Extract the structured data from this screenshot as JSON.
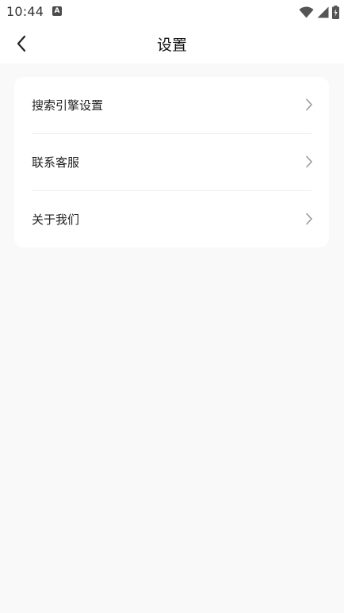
{
  "status_bar": {
    "time": "10:44",
    "notification_icon": "a-icon",
    "icons": [
      "wifi-icon",
      "signal-icon",
      "battery-icon"
    ]
  },
  "header": {
    "back_icon": "chevron-left-icon",
    "title": "设置"
  },
  "settings": {
    "items": [
      {
        "label": "搜索引擎设置",
        "icon": "chevron-right-icon"
      },
      {
        "label": "联系客服",
        "icon": "chevron-right-icon"
      },
      {
        "label": "关于我们",
        "icon": "chevron-right-icon"
      }
    ]
  },
  "colors": {
    "background": "#f9f9f9",
    "card": "#ffffff",
    "text": "#222222",
    "chevron": "#9a9a9a",
    "divider": "#efefef"
  }
}
